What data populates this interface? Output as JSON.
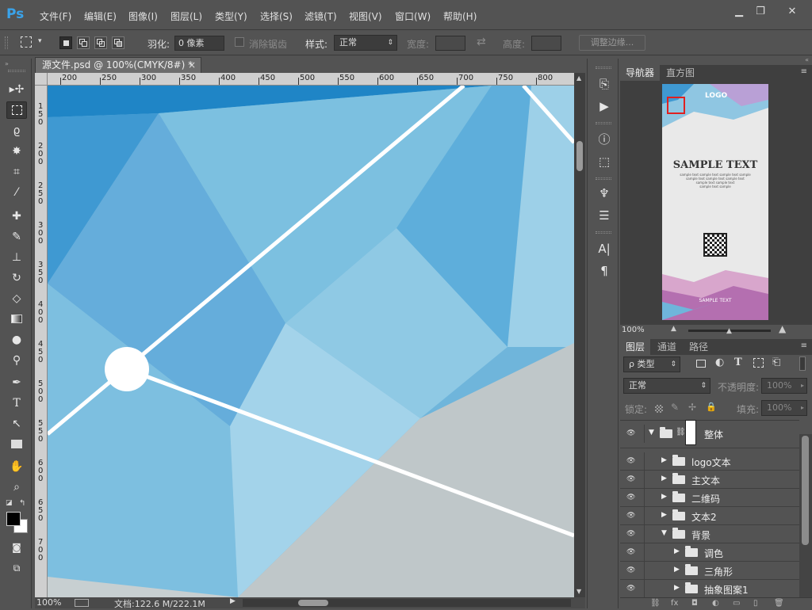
{
  "app": {
    "logo": "Ps"
  },
  "menu": [
    "文件(F)",
    "编辑(E)",
    "图像(I)",
    "图层(L)",
    "类型(Y)",
    "选择(S)",
    "滤镜(T)",
    "视图(V)",
    "窗口(W)",
    "帮助(H)"
  ],
  "window_controls": {
    "minimize": "▁",
    "restore": "❐",
    "close": "✕"
  },
  "options": {
    "feather_label": "羽化:",
    "feather_value": "0 像素",
    "antialias_label": "消除锯齿",
    "style_label": "样式:",
    "style_value": "正常",
    "width_label": "宽度:",
    "height_label": "高度:",
    "refine_edge": "调整边缘..."
  },
  "document": {
    "tab_title": "源文件.psd @ 100%(CMYK/8#) *",
    "tab_close": "×",
    "ruler_h": [
      "200",
      "250",
      "300",
      "350",
      "400",
      "450",
      "500",
      "550",
      "600",
      "650",
      "700",
      "750",
      "800"
    ],
    "ruler_v": [
      "150",
      "200",
      "250",
      "300",
      "350",
      "400",
      "450",
      "500",
      "550",
      "600",
      "650",
      "700"
    ]
  },
  "status": {
    "zoom": "100%",
    "doc_info": "文档:122.6 M/222.1M",
    "nav_arrow": "▶"
  },
  "navigator": {
    "tabs": [
      "导航器",
      "直方图"
    ],
    "zoom": "100%",
    "thumb_logo": "LOGO",
    "thumb_title": "SAMPLE TEXT",
    "thumb_lines": [
      "sample text sample text sample text sample",
      "sample text sample text sample text",
      "sample text sample text",
      "sample text sample"
    ],
    "thumb_footer": "SAMPLE TEXT"
  },
  "layers": {
    "tabs": [
      "图层",
      "通道",
      "路径"
    ],
    "filter_label": "ρ 类型",
    "blend_mode": "正常",
    "opacity_label": "不透明度:",
    "opacity_value": "100%",
    "lock_label": "锁定:",
    "fill_label": "填充:",
    "fill_value": "100%",
    "rows": [
      {
        "name": "整体",
        "indent": 0,
        "expanded": true,
        "mask": true
      },
      {
        "name": "logo文本",
        "indent": 1,
        "expanded": false
      },
      {
        "name": "主文本",
        "indent": 1,
        "expanded": false
      },
      {
        "name": "二维码",
        "indent": 1,
        "expanded": false
      },
      {
        "name": "文本2",
        "indent": 1,
        "expanded": false
      },
      {
        "name": "背景",
        "indent": 1,
        "expanded": true
      },
      {
        "name": "调色",
        "indent": 2,
        "expanded": false
      },
      {
        "name": "三角形",
        "indent": 2,
        "expanded": false
      },
      {
        "name": "抽象图案1",
        "indent": 2,
        "expanded": false
      }
    ],
    "footer_icons": [
      "⛓",
      "fx",
      "◘",
      "◐",
      "▭",
      "▯",
      "🗑"
    ]
  },
  "colors": {
    "accent": "#3aa3ea",
    "canvas_blue": "#6fb5db",
    "canvas_gray": "#bfc7c9"
  }
}
